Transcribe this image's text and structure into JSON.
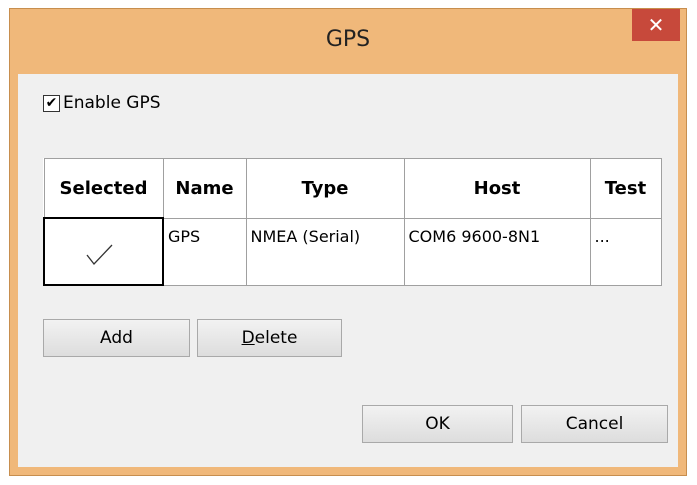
{
  "window": {
    "title": "GPS",
    "close_symbol": "✕"
  },
  "enable_gps": {
    "label": "Enable GPS",
    "checked": true,
    "check_glyph": "✔"
  },
  "table": {
    "headers": [
      "Selected",
      "Name",
      "Type",
      "Host",
      "Test"
    ],
    "rows": [
      {
        "selected": true,
        "name": "GPS",
        "type": "NMEA (Serial)",
        "host": "COM6 9600-8N1",
        "test": "..."
      }
    ]
  },
  "buttons": {
    "add": "Add",
    "delete_accel": "D",
    "delete_rest": "elete",
    "ok": "OK",
    "cancel": "Cancel"
  },
  "colors": {
    "title_bar": "#f0b87a",
    "close_button": "#c7493b"
  }
}
